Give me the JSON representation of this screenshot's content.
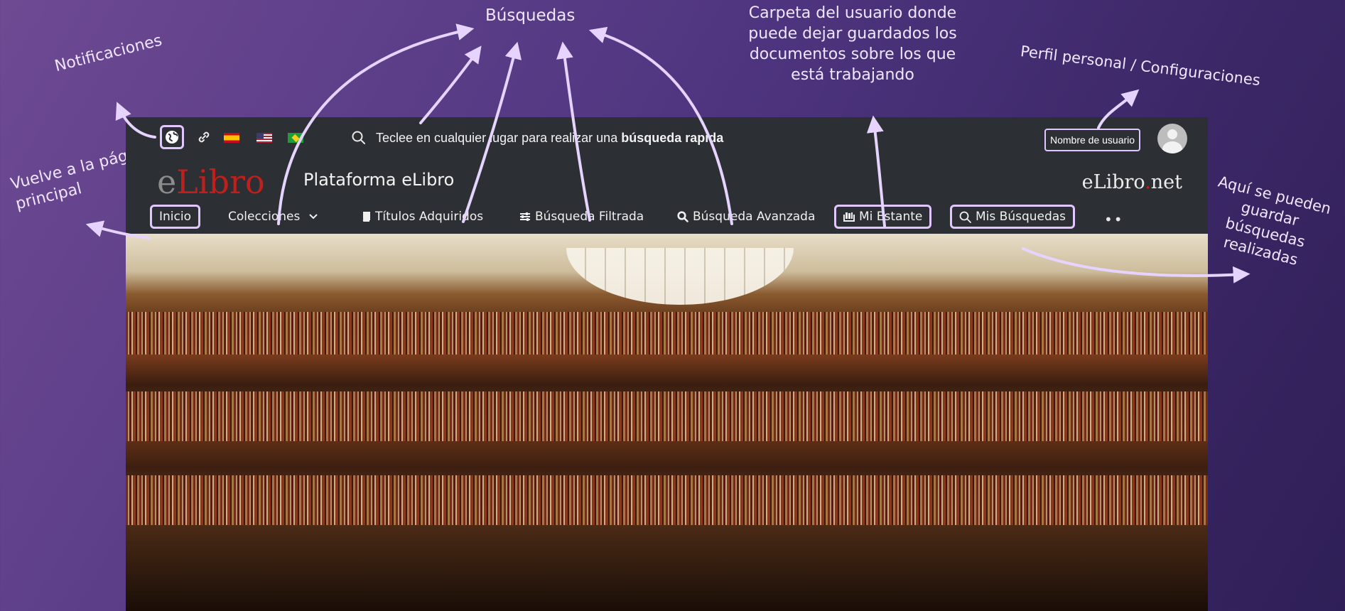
{
  "annotations": {
    "busquedas": "Búsquedas",
    "notificaciones": "Notificaciones",
    "inicio_line1": "Vuelve a la página",
    "inicio_line2": "principal",
    "estante_line1": "Carpeta del usuario donde",
    "estante_line2": "puede dejar guardados los",
    "estante_line3": "documentos sobre los que",
    "estante_line4": "está trabajando",
    "perfil": "Perfil personal / Configuraciones",
    "guardar_line1": "Aquí se pueden",
    "guardar_line2": "guardar búsquedas",
    "guardar_line3": "realizadas"
  },
  "topbar": {
    "quick_search_text": "Teclee en cualquier lugar para realizar una ",
    "quick_search_bold": "búsqueda rapida",
    "user_name": "Nombre de usuario"
  },
  "brand": {
    "logo_e": "e",
    "logo_libro": "Libro",
    "platform_title": "Plataforma eLibro",
    "right_logo_a": "eLibro",
    "right_logo_dot": ".",
    "right_logo_b": "net"
  },
  "nav": {
    "inicio": "Inicio",
    "colecciones": "Colecciones",
    "titulos": "Títulos Adquiridos",
    "filtrada": "Búsqueda Filtrada",
    "avanzada": "Búsqueda Avanzada",
    "estante": "Mi Estante",
    "mis_busquedas": "Mis Búsquedas",
    "more": "••"
  },
  "colors": {
    "accent_outline": "#e2c6ff",
    "logo_red": "#c0201c",
    "navbar_bg": "#2c2f33"
  }
}
